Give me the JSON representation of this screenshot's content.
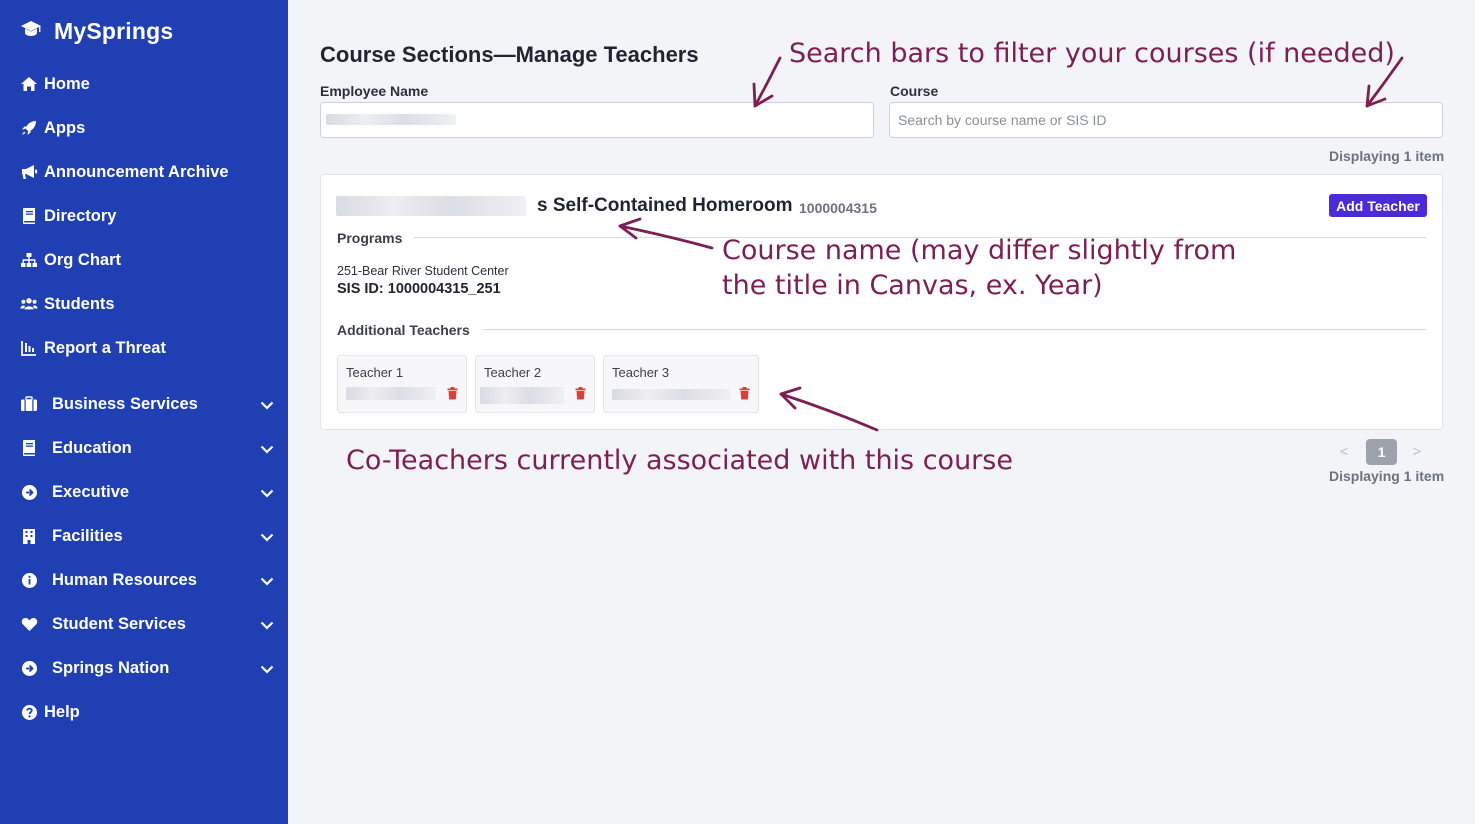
{
  "app": {
    "brand": "MySprings",
    "brand_icon": "graduation-cap-icon"
  },
  "sidebar": {
    "items": [
      {
        "label": "Home",
        "icon": "home-icon"
      },
      {
        "label": "Apps",
        "icon": "rocket-icon"
      },
      {
        "label": "Announcement Archive",
        "icon": "megaphone-icon"
      },
      {
        "label": "Directory",
        "icon": "book-icon"
      },
      {
        "label": "Org Chart",
        "icon": "sitemap-icon"
      },
      {
        "label": "Students",
        "icon": "users-icon"
      },
      {
        "label": "Report a Threat",
        "icon": "chart-icon"
      }
    ],
    "groups": [
      {
        "label": "Business Services",
        "icon": "briefcase-icon"
      },
      {
        "label": "Education",
        "icon": "book-icon"
      },
      {
        "label": "Executive",
        "icon": "arrow-circle-icon"
      },
      {
        "label": "Facilities",
        "icon": "building-icon"
      },
      {
        "label": "Human Resources",
        "icon": "info-circle-icon"
      },
      {
        "label": "Student Services",
        "icon": "heart-icon"
      },
      {
        "label": "Springs Nation",
        "icon": "arrow-circle-icon"
      }
    ],
    "help": {
      "label": "Help",
      "icon": "question-circle-icon"
    }
  },
  "main": {
    "title": "Course Sections—Manage Teachers",
    "employee_label": "Employee Name",
    "employee_value": "",
    "course_label": "Course",
    "course_placeholder": "Search by course name or SIS ID",
    "displaying_top": "Displaying 1 item",
    "displaying_bottom": "Displaying 1 item",
    "page_current": "1",
    "prev_label": "<",
    "next_label": ">"
  },
  "course": {
    "title_suffix": "s Self-Contained Homeroom",
    "id": "1000004315",
    "add_teacher_label": "Add Teacher",
    "programs_label": "Programs",
    "program_name": "251-Bear River Student Center",
    "sis_id": "SIS ID: 1000004315_251",
    "additional_label": "Additional Teachers",
    "teachers": [
      {
        "label": "Teacher 1"
      },
      {
        "label": "Teacher 2"
      },
      {
        "label": "Teacher 3"
      }
    ]
  },
  "annotations": {
    "search": "Search bars to filter your courses (if needed)",
    "course_line1": "Course name (may differ slightly from",
    "course_line2": "the title in Canvas, ex. Year)",
    "coteachers": "Co-Teachers currently associated with this course",
    "color": "#7c1f52"
  },
  "colors": {
    "sidebar": "#1f3fb3",
    "accent": "#4a2bd6",
    "delete": "#e23b3b"
  }
}
